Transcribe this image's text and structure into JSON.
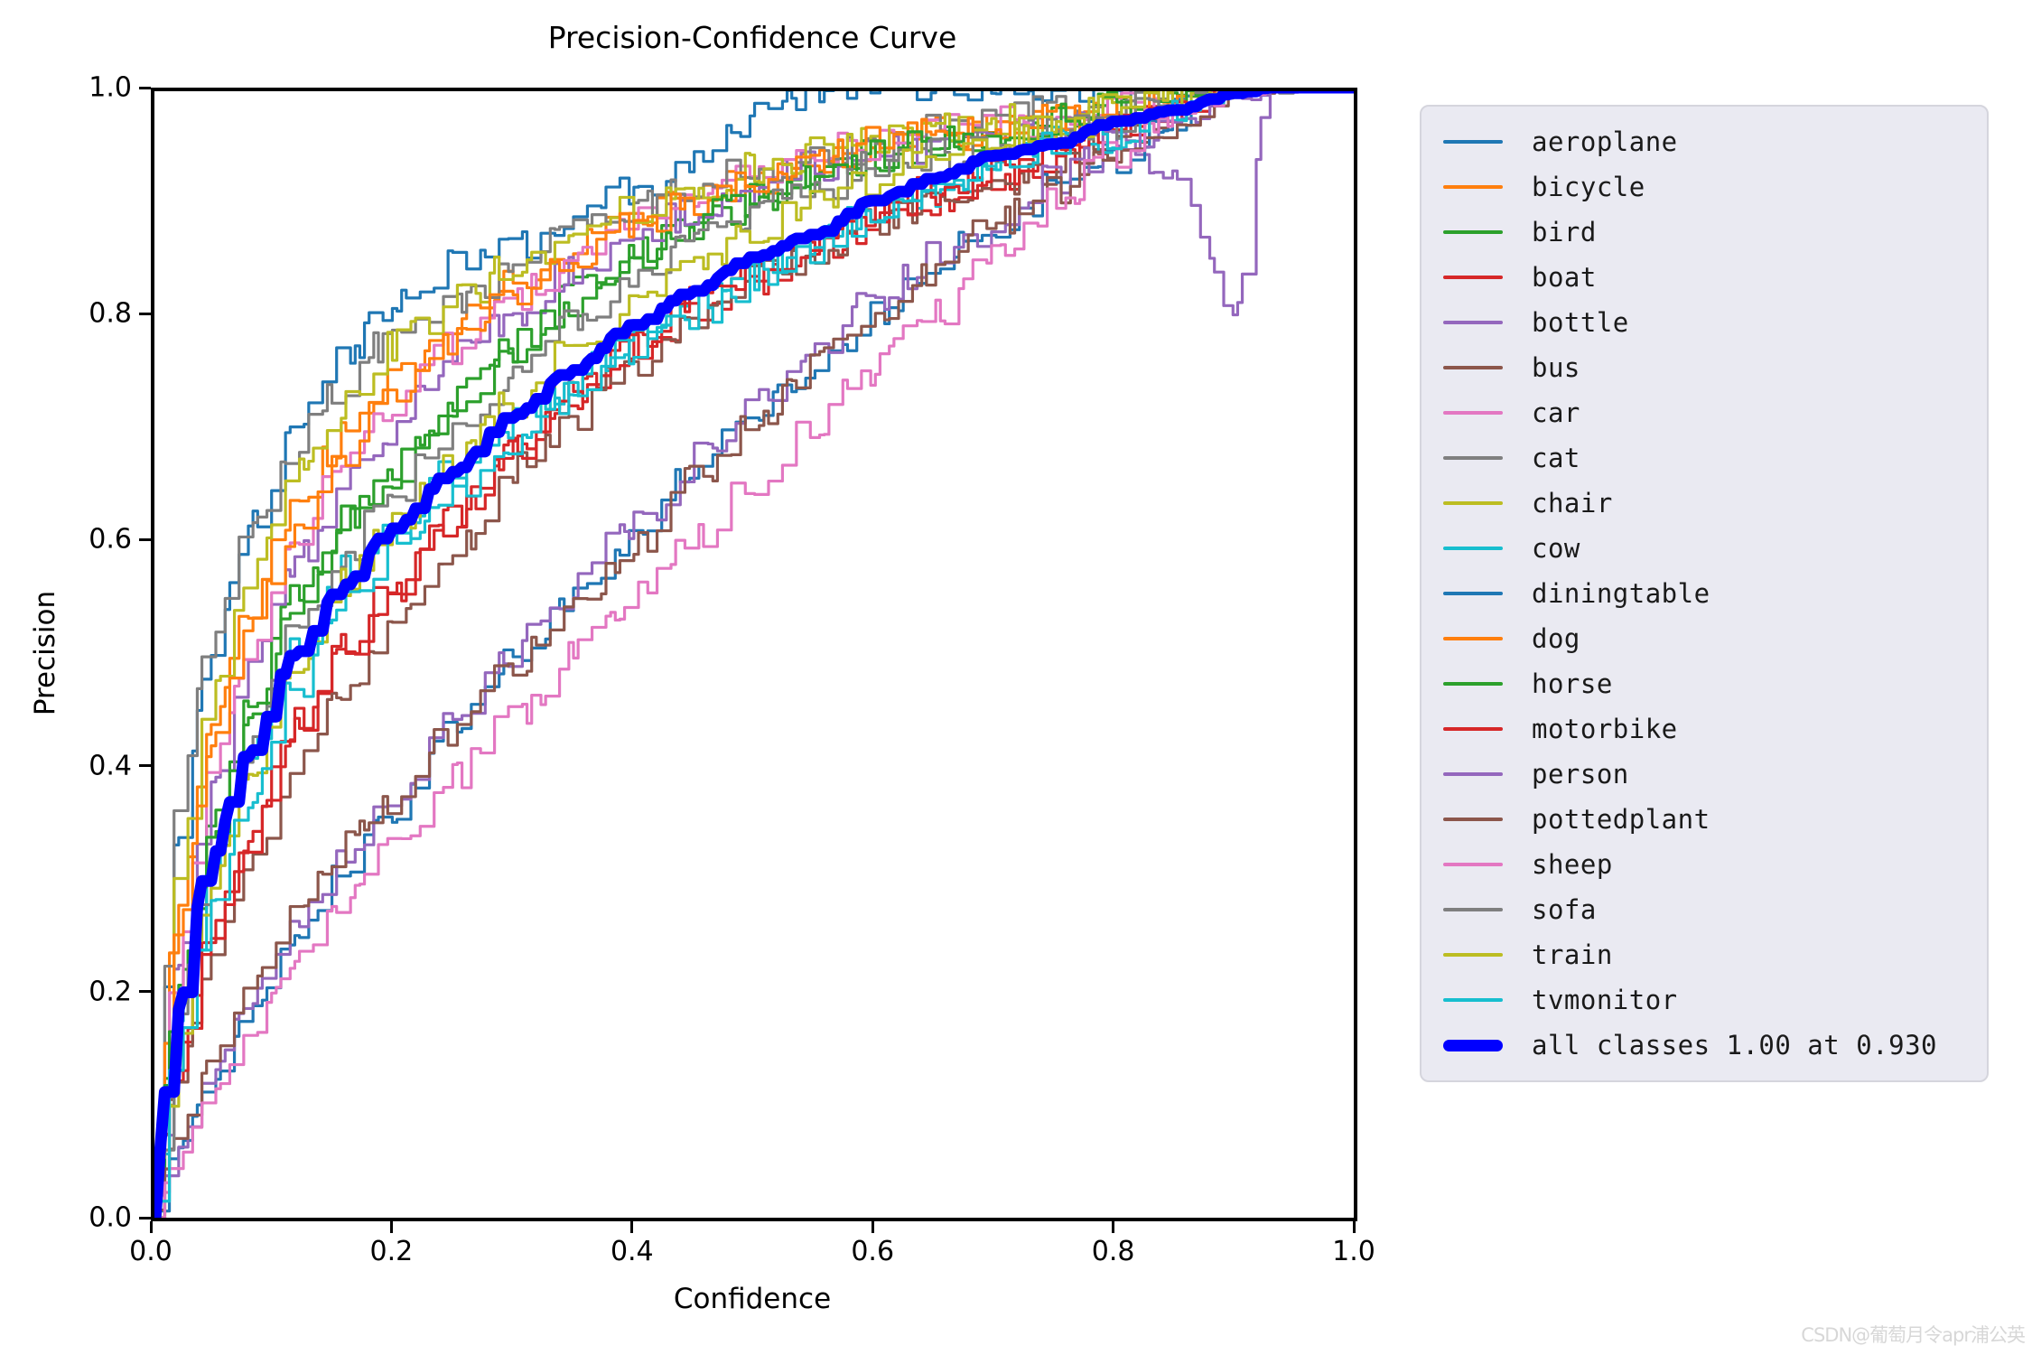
{
  "figure": {
    "title": "Precision-Confidence Curve",
    "watermark": "CSDN@葡萄月令apr浦公英"
  },
  "axes": {
    "xlabel": "Confidence",
    "ylabel": "Precision",
    "xticks": [
      "0.0",
      "0.2",
      "0.4",
      "0.6",
      "0.8",
      "1.0"
    ],
    "yticks": [
      "0.0",
      "0.2",
      "0.4",
      "0.6",
      "0.8",
      "1.0"
    ],
    "xlim": [
      0.0,
      1.0
    ],
    "ylim": [
      0.0,
      1.0
    ]
  },
  "legend": {
    "entries": [
      {
        "label": "aeroplane",
        "color": "#1f77b4"
      },
      {
        "label": "bicycle",
        "color": "#ff7f0e"
      },
      {
        "label": "bird",
        "color": "#2ca02c"
      },
      {
        "label": "boat",
        "color": "#d62728"
      },
      {
        "label": "bottle",
        "color": "#9467bd"
      },
      {
        "label": "bus",
        "color": "#8c564b"
      },
      {
        "label": "car",
        "color": "#e377c2"
      },
      {
        "label": "cat",
        "color": "#7f7f7f"
      },
      {
        "label": "chair",
        "color": "#bcbd22"
      },
      {
        "label": "cow",
        "color": "#17becf"
      },
      {
        "label": "diningtable",
        "color": "#1f77b4"
      },
      {
        "label": "dog",
        "color": "#ff7f0e"
      },
      {
        "label": "horse",
        "color": "#2ca02c"
      },
      {
        "label": "motorbike",
        "color": "#d62728"
      },
      {
        "label": "person",
        "color": "#9467bd"
      },
      {
        "label": "pottedplant",
        "color": "#8c564b"
      },
      {
        "label": "sheep",
        "color": "#e377c2"
      },
      {
        "label": "sofa",
        "color": "#7f7f7f"
      },
      {
        "label": "train",
        "color": "#bcbd22"
      },
      {
        "label": "tvmonitor",
        "color": "#17becf"
      },
      {
        "label": "all classes 1.00 at 0.930",
        "color": "#0000ff"
      }
    ]
  },
  "chart_data": {
    "type": "line",
    "title": "Precision-Confidence Curve",
    "xlabel": "Confidence",
    "ylabel": "Precision",
    "xlim": [
      0.0,
      1.0
    ],
    "ylim": [
      0.0,
      1.0
    ],
    "grid": false,
    "legend_position": "right",
    "x": [
      0.0,
      0.02,
      0.05,
      0.08,
      0.12,
      0.16,
      0.2,
      0.25,
      0.3,
      0.35,
      0.4,
      0.45,
      0.5,
      0.55,
      0.6,
      0.65,
      0.7,
      0.75,
      0.8,
      0.85,
      0.9,
      0.93,
      1.0
    ],
    "series": [
      {
        "name": "aeroplane",
        "color": "#1f77b4",
        "values": [
          0.0,
          0.33,
          0.5,
          0.61,
          0.7,
          0.76,
          0.81,
          0.84,
          0.86,
          0.88,
          0.91,
          0.94,
          0.97,
          1.0,
          1.0,
          1.0,
          1.0,
          1.0,
          1.0,
          1.0,
          1.0,
          1.0,
          1.0
        ]
      },
      {
        "name": "bicycle",
        "color": "#ff7f0e",
        "values": [
          0.0,
          0.27,
          0.44,
          0.54,
          0.63,
          0.69,
          0.74,
          0.79,
          0.83,
          0.86,
          0.89,
          0.9,
          0.92,
          0.93,
          0.95,
          0.96,
          0.96,
          0.97,
          0.98,
          0.99,
          1.0,
          1.0,
          1.0
        ]
      },
      {
        "name": "bird",
        "color": "#2ca02c",
        "values": [
          0.0,
          0.2,
          0.35,
          0.45,
          0.55,
          0.62,
          0.66,
          0.72,
          0.77,
          0.82,
          0.85,
          0.88,
          0.9,
          0.92,
          0.94,
          0.95,
          0.96,
          0.97,
          0.98,
          0.99,
          1.0,
          1.0,
          1.0
        ]
      },
      {
        "name": "boat",
        "color": "#d62728",
        "values": [
          0.0,
          0.14,
          0.26,
          0.34,
          0.44,
          0.51,
          0.56,
          0.62,
          0.68,
          0.73,
          0.77,
          0.8,
          0.83,
          0.86,
          0.88,
          0.9,
          0.92,
          0.94,
          0.96,
          0.98,
          1.0,
          1.0,
          1.0
        ]
      },
      {
        "name": "bottle",
        "color": "#9467bd",
        "values": [
          0.0,
          0.22,
          0.38,
          0.49,
          0.58,
          0.65,
          0.7,
          0.76,
          0.8,
          0.84,
          0.87,
          0.89,
          0.91,
          0.93,
          0.94,
          0.95,
          0.96,
          0.96,
          0.97,
          0.92,
          0.8,
          1.0,
          1.0
        ]
      },
      {
        "name": "bus",
        "color": "#8c564b",
        "values": [
          0.0,
          0.12,
          0.23,
          0.31,
          0.4,
          0.46,
          0.52,
          0.59,
          0.66,
          0.71,
          0.76,
          0.79,
          0.83,
          0.85,
          0.88,
          0.9,
          0.91,
          0.93,
          0.95,
          0.97,
          1.0,
          1.0,
          1.0
        ]
      },
      {
        "name": "car",
        "color": "#e377c2",
        "values": [
          0.0,
          0.23,
          0.4,
          0.5,
          0.6,
          0.67,
          0.72,
          0.77,
          0.81,
          0.85,
          0.88,
          0.9,
          0.92,
          0.94,
          0.95,
          0.96,
          0.97,
          0.97,
          0.98,
          0.99,
          1.0,
          1.0,
          1.0
        ]
      },
      {
        "name": "cat",
        "color": "#7f7f7f",
        "values": [
          0.0,
          0.36,
          0.52,
          0.61,
          0.69,
          0.74,
          0.78,
          0.81,
          0.84,
          0.87,
          0.89,
          0.91,
          0.93,
          0.94,
          0.95,
          0.96,
          0.97,
          0.98,
          0.98,
          0.99,
          1.0,
          1.0,
          1.0
        ]
      },
      {
        "name": "chair",
        "color": "#bcbd22",
        "values": [
          0.0,
          0.3,
          0.47,
          0.57,
          0.66,
          0.72,
          0.77,
          0.81,
          0.84,
          0.87,
          0.89,
          0.91,
          0.93,
          0.94,
          0.95,
          0.96,
          0.97,
          0.97,
          0.98,
          0.99,
          1.0,
          1.0,
          1.0
        ]
      },
      {
        "name": "cow",
        "color": "#17becf",
        "values": [
          0.0,
          0.17,
          0.31,
          0.41,
          0.5,
          0.57,
          0.61,
          0.66,
          0.7,
          0.74,
          0.78,
          0.81,
          0.84,
          0.86,
          0.89,
          0.91,
          0.93,
          0.95,
          0.96,
          0.98,
          1.0,
          1.0,
          1.0
        ]
      },
      {
        "name": "diningtable",
        "color": "#1f77b4",
        "values": [
          0.0,
          0.06,
          0.12,
          0.18,
          0.25,
          0.31,
          0.36,
          0.43,
          0.49,
          0.55,
          0.6,
          0.66,
          0.71,
          0.75,
          0.8,
          0.84,
          0.88,
          0.91,
          0.94,
          0.97,
          1.0,
          1.0,
          1.0
        ]
      },
      {
        "name": "dog",
        "color": "#ff7f0e",
        "values": [
          0.0,
          0.25,
          0.42,
          0.52,
          0.62,
          0.68,
          0.73,
          0.78,
          0.82,
          0.85,
          0.88,
          0.9,
          0.92,
          0.93,
          0.95,
          0.96,
          0.96,
          0.97,
          0.98,
          0.99,
          1.0,
          1.0,
          1.0
        ]
      },
      {
        "name": "horse",
        "color": "#2ca02c",
        "values": [
          0.0,
          0.19,
          0.34,
          0.44,
          0.54,
          0.61,
          0.66,
          0.72,
          0.77,
          0.81,
          0.85,
          0.88,
          0.9,
          0.92,
          0.94,
          0.95,
          0.96,
          0.97,
          0.98,
          0.99,
          1.0,
          1.0,
          1.0
        ]
      },
      {
        "name": "motorbike",
        "color": "#d62728",
        "values": [
          0.0,
          0.13,
          0.25,
          0.33,
          0.43,
          0.5,
          0.55,
          0.62,
          0.68,
          0.73,
          0.77,
          0.81,
          0.84,
          0.86,
          0.89,
          0.91,
          0.92,
          0.94,
          0.96,
          0.98,
          1.0,
          1.0,
          1.0
        ]
      },
      {
        "name": "person",
        "color": "#9467bd",
        "values": [
          0.0,
          0.06,
          0.13,
          0.19,
          0.26,
          0.32,
          0.37,
          0.44,
          0.5,
          0.56,
          0.61,
          0.67,
          0.72,
          0.77,
          0.81,
          0.85,
          0.88,
          0.92,
          0.95,
          0.97,
          0.99,
          1.0,
          1.0
        ]
      },
      {
        "name": "pottedplant",
        "color": "#8c564b",
        "values": [
          0.0,
          0.07,
          0.14,
          0.2,
          0.27,
          0.33,
          0.37,
          0.43,
          0.49,
          0.54,
          0.59,
          0.65,
          0.7,
          0.75,
          0.8,
          0.84,
          0.88,
          0.91,
          0.94,
          0.97,
          1.0,
          1.0,
          1.0
        ]
      },
      {
        "name": "sheep",
        "color": "#e377c2",
        "values": [
          0.0,
          0.05,
          0.11,
          0.16,
          0.23,
          0.28,
          0.33,
          0.39,
          0.44,
          0.5,
          0.55,
          0.6,
          0.65,
          0.7,
          0.75,
          0.8,
          0.85,
          0.9,
          0.94,
          0.97,
          1.0,
          1.0,
          1.0
        ]
      },
      {
        "name": "sofa",
        "color": "#7f7f7f",
        "values": [
          0.0,
          0.18,
          0.32,
          0.42,
          0.52,
          0.59,
          0.64,
          0.7,
          0.75,
          0.79,
          0.83,
          0.86,
          0.89,
          0.91,
          0.93,
          0.94,
          0.95,
          0.96,
          0.97,
          0.99,
          1.0,
          1.0,
          1.0
        ]
      },
      {
        "name": "train",
        "color": "#bcbd22",
        "values": [
          0.0,
          0.16,
          0.29,
          0.39,
          0.49,
          0.56,
          0.61,
          0.67,
          0.72,
          0.77,
          0.81,
          0.84,
          0.87,
          0.9,
          0.92,
          0.94,
          0.95,
          0.96,
          0.98,
          0.99,
          1.0,
          1.0,
          1.0
        ]
      },
      {
        "name": "tvmonitor",
        "color": "#17becf",
        "values": [
          0.0,
          0.15,
          0.28,
          0.37,
          0.47,
          0.54,
          0.59,
          0.64,
          0.69,
          0.73,
          0.77,
          0.8,
          0.83,
          0.86,
          0.89,
          0.91,
          0.93,
          0.95,
          0.96,
          0.98,
          1.0,
          1.0,
          1.0
        ]
      },
      {
        "name": "all classes",
        "color": "#0000ff",
        "thick": true,
        "values": [
          0.0,
          0.18,
          0.32,
          0.41,
          0.5,
          0.56,
          0.61,
          0.66,
          0.71,
          0.75,
          0.79,
          0.82,
          0.85,
          0.87,
          0.9,
          0.92,
          0.94,
          0.95,
          0.97,
          0.98,
          0.995,
          1.0,
          1.0
        ]
      }
    ],
    "annotation": "all classes 1.00 at 0.930"
  }
}
